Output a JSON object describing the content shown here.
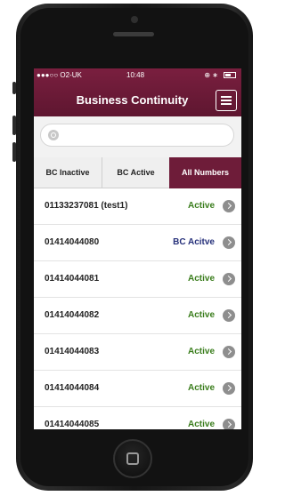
{
  "status_bar": {
    "carrier": "●●●○○ O2-UK",
    "time": "10:48",
    "icons": "⊕ ∗"
  },
  "header": {
    "title": "Business Continuity",
    "menu_icon": "hamburger-icon"
  },
  "search": {
    "value": "",
    "placeholder": ""
  },
  "tabs": [
    {
      "label": "BC Inactive",
      "selected": false
    },
    {
      "label": "BC Active",
      "selected": false
    },
    {
      "label": "All Numbers",
      "selected": true
    }
  ],
  "numbers": [
    {
      "number": "01133237081 (test1)",
      "status": "Active"
    },
    {
      "number": "01414044080",
      "status": "BC Acitve"
    },
    {
      "number": "01414044081",
      "status": "Active"
    },
    {
      "number": "01414044082",
      "status": "Active"
    },
    {
      "number": "01414044083",
      "status": "Active"
    },
    {
      "number": "01414044084",
      "status": "Active"
    },
    {
      "number": "01414044085",
      "status": "Active"
    }
  ],
  "colors": {
    "brand": "#6e1c39",
    "active": "#3a7d1c",
    "bc_active": "#26307a"
  }
}
